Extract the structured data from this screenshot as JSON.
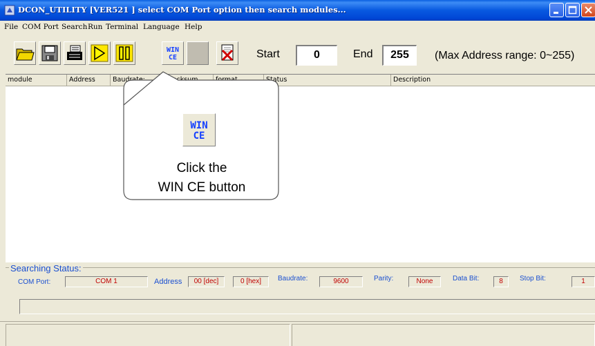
{
  "window": {
    "title": "DCON_UTILITY [VER521 ] select COM Port option then search modules...",
    "app_icon": "dcon-app-icon",
    "controls": [
      "minimize-icon",
      "maximize-icon",
      "close-icon"
    ]
  },
  "menu": [
    "File",
    "COM Port",
    "Search",
    "Run",
    "Terminal",
    "Language",
    "Help"
  ],
  "toolbar": {
    "buttons": [
      {
        "icon": "open-folder-icon",
        "enabled": true
      },
      {
        "icon": "save-disk-icon",
        "enabled": true
      },
      {
        "icon": "printer-icon",
        "enabled": true
      },
      {
        "icon": "play-icon",
        "enabled": true
      },
      {
        "icon": "pause-icon",
        "enabled": true
      },
      {
        "icon": "wince-icon",
        "label": "WIN CE",
        "enabled": true
      },
      {
        "icon": "blank-icon",
        "enabled": false
      },
      {
        "icon": "stop-search-icon",
        "enabled": true
      }
    ],
    "start_label": "Start",
    "start_value": "0",
    "end_label": "End",
    "end_value": "255",
    "range_note": "(Max Address range: 0~255)"
  },
  "list": {
    "columns": [
      "module",
      "Address",
      "Baudrate:",
      "Checksum",
      "format",
      "Status",
      "Description"
    ],
    "rows": []
  },
  "callout": {
    "icon_label": "WIN CE",
    "line1": "Click the",
    "line2": "WIN CE button"
  },
  "searching_status": {
    "title": "Searching Status:",
    "com_port_label": "COM Port:",
    "com_port_value": "COM 1",
    "address_label": "Address",
    "address_dec": "00 [dec]",
    "address_hex": "0 [hex]",
    "baudrate_label": "Baudrate:",
    "baudrate_value": "9600",
    "parity_label": "Parity:",
    "parity_value": "None",
    "data_bit_label": "Data Bit:",
    "data_bit_value": "8",
    "stop_bit_label": "Stop Bit:",
    "stop_bit_value": "1"
  },
  "colors": {
    "titlebar": "#0a5fe0",
    "status_label": "#1a4fd0",
    "status_value": "#c00000",
    "window_bg": "#ece9d8"
  }
}
